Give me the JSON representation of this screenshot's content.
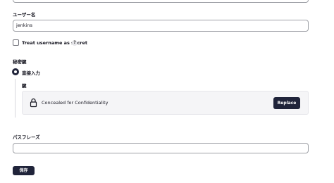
{
  "username": {
    "label": "ユーザー名",
    "value": "jenkins"
  },
  "treat_secret": {
    "label": "Treat username as secret",
    "help": "?",
    "checked": false
  },
  "private_key": {
    "label": "秘密鍵",
    "option_label": "直接入力",
    "key_label": "鍵",
    "concealed_text": "Concealed for Confidentiality",
    "replace_label": "Replace"
  },
  "passphrase": {
    "label": "パスフレーズ",
    "value": ""
  },
  "save_label": "保存",
  "icons": {
    "lock": "lock-icon"
  },
  "colors": {
    "primary": "#20243a",
    "panel": "#f5f5f7",
    "border": "#9ea0a6"
  }
}
